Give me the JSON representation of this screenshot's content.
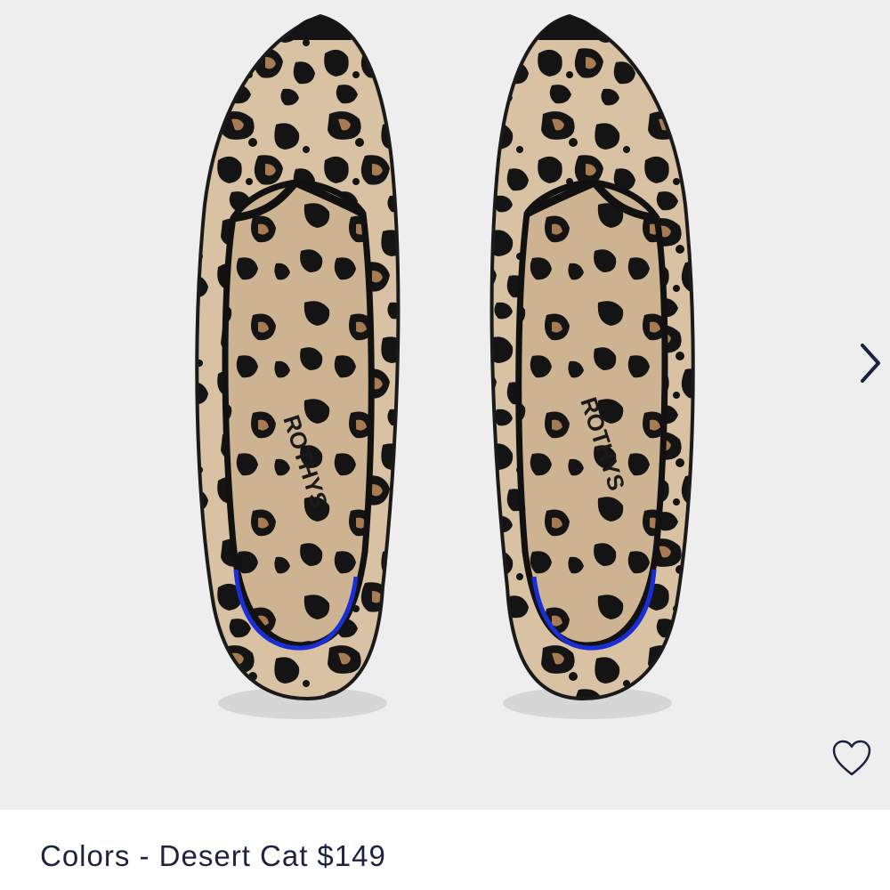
{
  "product": {
    "color_label": "Colors - Desert Cat",
    "price": "$149",
    "brand_text": "ROTHYS"
  },
  "gallery": {
    "next_icon": "chevron-right-icon",
    "wishlist_icon": "heart-outline-icon"
  },
  "colors": {
    "background": "#eeeeee",
    "knit_beige": "#d9c2a3",
    "spot_black": "#141414",
    "spot_tan": "#a77a52",
    "heel_blue": "#1a2ed8",
    "text_navy": "#1c2340"
  }
}
